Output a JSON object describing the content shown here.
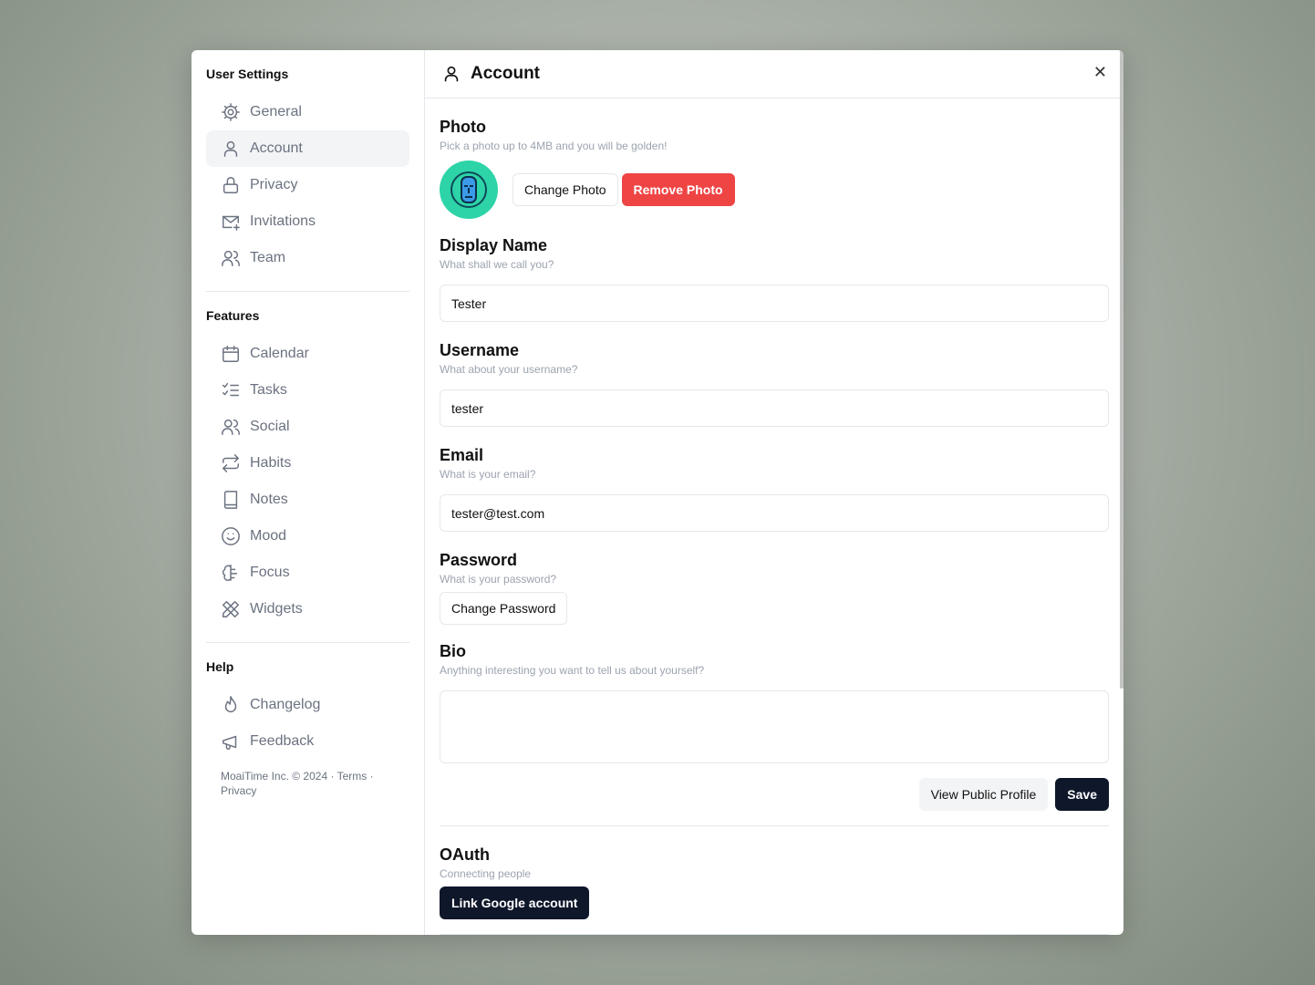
{
  "sidebar": {
    "user_settings_title": "User Settings",
    "user_items": [
      {
        "label": "General",
        "icon": "gear-icon"
      },
      {
        "label": "Account",
        "icon": "user-icon"
      },
      {
        "label": "Privacy",
        "icon": "lock-icon"
      },
      {
        "label": "Invitations",
        "icon": "mail-plus-icon"
      },
      {
        "label": "Team",
        "icon": "users-icon"
      }
    ],
    "features_title": "Features",
    "feature_items": [
      {
        "label": "Calendar",
        "icon": "calendar-icon"
      },
      {
        "label": "Tasks",
        "icon": "list-checks-icon"
      },
      {
        "label": "Social",
        "icon": "users-icon"
      },
      {
        "label": "Habits",
        "icon": "repeat-icon"
      },
      {
        "label": "Notes",
        "icon": "book-icon"
      },
      {
        "label": "Mood",
        "icon": "smile-icon"
      },
      {
        "label": "Focus",
        "icon": "brain-icon"
      },
      {
        "label": "Widgets",
        "icon": "pencil-ruler-icon"
      }
    ],
    "help_title": "Help",
    "help_items": [
      {
        "label": "Changelog",
        "icon": "flame-icon"
      },
      {
        "label": "Feedback",
        "icon": "megaphone-icon"
      }
    ],
    "footer": {
      "copyright": "MoaiTime Inc. © 2024 ·",
      "terms": "Terms",
      "sep": "·",
      "privacy": "Privacy"
    }
  },
  "header": {
    "title": "Account"
  },
  "photo": {
    "title": "Photo",
    "subtitle": "Pick a photo up to 4MB and you will be golden!",
    "change": "Change Photo",
    "remove": "Remove Photo"
  },
  "display_name": {
    "title": "Display Name",
    "subtitle": "What shall we call you?",
    "value": "Tester"
  },
  "username": {
    "title": "Username",
    "subtitle": "What about your username?",
    "value": "tester"
  },
  "email": {
    "title": "Email",
    "subtitle": "What is your email?",
    "value": "tester@test.com"
  },
  "password": {
    "title": "Password",
    "subtitle": "What is your password?",
    "button": "Change Password"
  },
  "bio": {
    "title": "Bio",
    "subtitle": "Anything interesting you want to tell us about yourself?",
    "value": ""
  },
  "actions": {
    "view_profile": "View Public Profile",
    "save": "Save"
  },
  "oauth": {
    "title": "OAuth",
    "subtitle": "Connecting people",
    "button": "Link Google account"
  },
  "colors": {
    "danger": "#ef4444",
    "primary": "#0f172a",
    "avatar_bg": "#2dd4a7"
  }
}
